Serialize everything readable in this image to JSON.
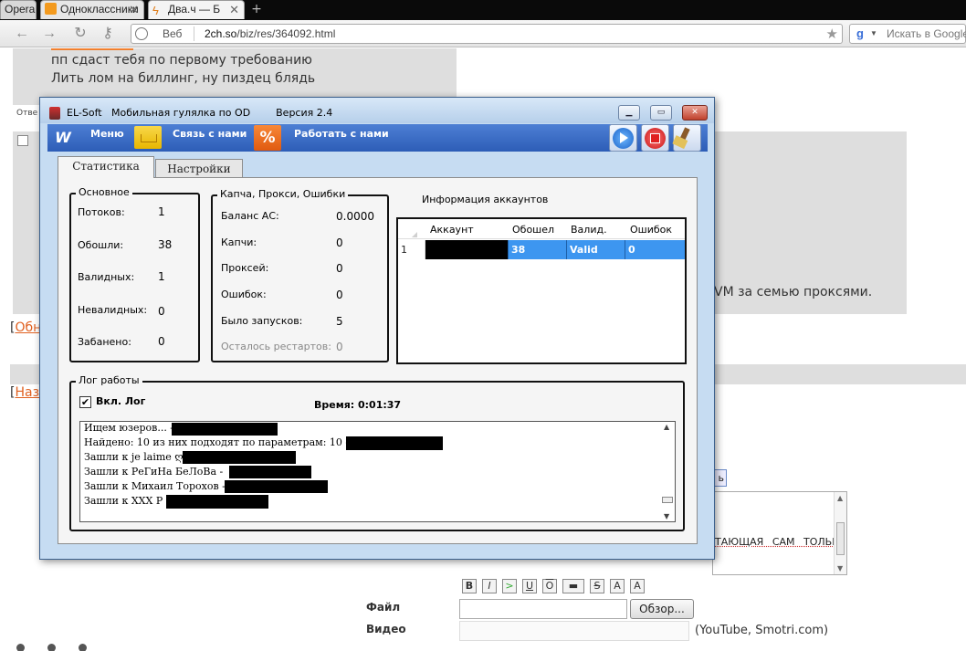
{
  "browser": {
    "tabs": [
      {
        "label": "Opera"
      },
      {
        "label": "Одноклассники"
      },
      {
        "label": "Два.ч — Б"
      }
    ],
    "address": {
      "scope": "Веб",
      "url_host": "2ch.so",
      "url_path": "/biz/res/364092.html"
    },
    "search": {
      "placeholder": "Искать в Google"
    }
  },
  "background_page": {
    "post1_line1": "пп сдаст тебя по первому требованию",
    "post1_line2": "Лить лом на биллинг, ну пиздец блядь",
    "reply_label": "Отве",
    "post2_text_fragment": "VM за семью проксями.",
    "link1": "Обн",
    "link2": "Наз",
    "textarea_fragment": "ТАЮЩАЯ САМ ТОЛЬКО",
    "format_buttons": [
      "B",
      "I",
      ">",
      "U",
      "O",
      "▬",
      "S",
      "A",
      "A"
    ],
    "file_label": "Файл",
    "file_button": "Обзор...",
    "video_label": "Видео",
    "video_hint": "(YouTube, Smotri.com)"
  },
  "app": {
    "title": "EL-Soft   Мобильная гулялка по OD        Версия 2.4",
    "toolbar": {
      "menu": "Меню",
      "contact": "Связь с нами",
      "work": "Работать с нами",
      "menu_icon_glyph": "W",
      "percent_glyph": "%"
    },
    "tabs": {
      "stats": "Статистика",
      "settings": "Настройки"
    },
    "basic": {
      "title": "Основное",
      "threads_label": "Потоков:",
      "threads": "1",
      "visited_label": "Обошли:",
      "visited": "38",
      "valid_label": "Валидных:",
      "valid": "1",
      "invalid_label": "Невалидных:",
      "invalid": "0",
      "banned_label": "Забанено:",
      "banned": "0"
    },
    "captcha": {
      "title": "Капча, Прокси, Ошибки",
      "balance_label": "Баланс АС:",
      "balance": "0.0000",
      "captchas_label": "Капчи:",
      "captchas": "0",
      "proxies_label": "Проксей:",
      "proxies": "0",
      "errors_label": "Ошибок:",
      "errors": "0",
      "launches_label": "Было запусков:",
      "launches": "5",
      "restarts_label": "Осталось рестартов:",
      "restarts": "0"
    },
    "accounts": {
      "title": "Информация аккаунтов",
      "columns": [
        "Аккаунт",
        "Обошел",
        "Валид.",
        "Ошибок"
      ],
      "rows": [
        {
          "num": "1",
          "visited": "38",
          "valid": "Valid",
          "errors": "0"
        }
      ]
    },
    "log": {
      "title": "Лог работы",
      "check_label": "Вкл. Лог",
      "time_label": "Время:",
      "time": "0:01:37",
      "lines": [
        "Ищем юзеров... -",
        "Найдено: 10 из них подходят по параметрам: 10 -",
        "Зашли к je laime ღ -",
        "Зашли к РеГиНа БеЛоВа -",
        "Зашли к Михаил Торохов -",
        "Зашли к XXX P -"
      ]
    }
  }
}
